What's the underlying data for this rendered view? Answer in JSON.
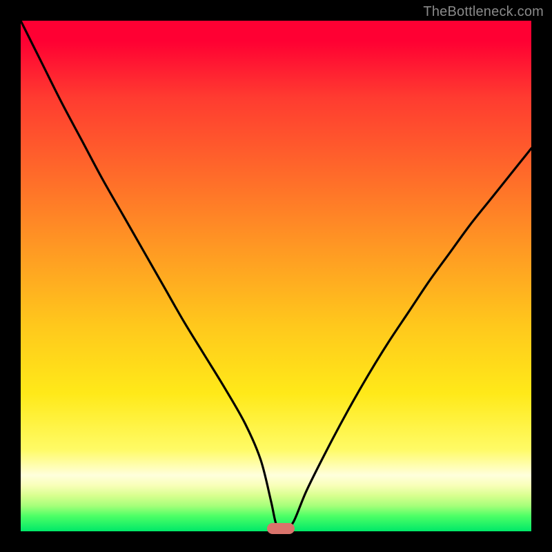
{
  "watermark": "TheBottleneck.com",
  "colors": {
    "page_bg": "#000000",
    "curve": "#000000",
    "marker": "#d9736b",
    "gradient_top": "#ff0033",
    "gradient_bottom": "#00e868"
  },
  "chart_data": {
    "type": "line",
    "title": "",
    "xlabel": "",
    "ylabel": "",
    "xlim": [
      0,
      100
    ],
    "ylim": [
      0,
      100
    ],
    "grid": false,
    "legend": false,
    "series": [
      {
        "name": "bottleneck-curve",
        "x": [
          0,
          4,
          8,
          12,
          16,
          20,
          24,
          28,
          32,
          36,
          40,
          44,
          47,
          49,
          50,
          51,
          52,
          53.5,
          56,
          60,
          64,
          68,
          72,
          76,
          80,
          84,
          88,
          92,
          96,
          100
        ],
        "y": [
          100,
          92,
          84,
          76.5,
          69,
          62,
          55,
          48,
          41,
          34.5,
          28,
          21,
          14,
          6,
          1.5,
          0.5,
          0.5,
          2,
          8,
          16,
          23.5,
          30.5,
          37,
          43,
          49,
          54.5,
          60,
          65,
          70,
          75
        ]
      }
    ],
    "marker": {
      "x": 51,
      "y": 0.5,
      "label": ""
    }
  }
}
